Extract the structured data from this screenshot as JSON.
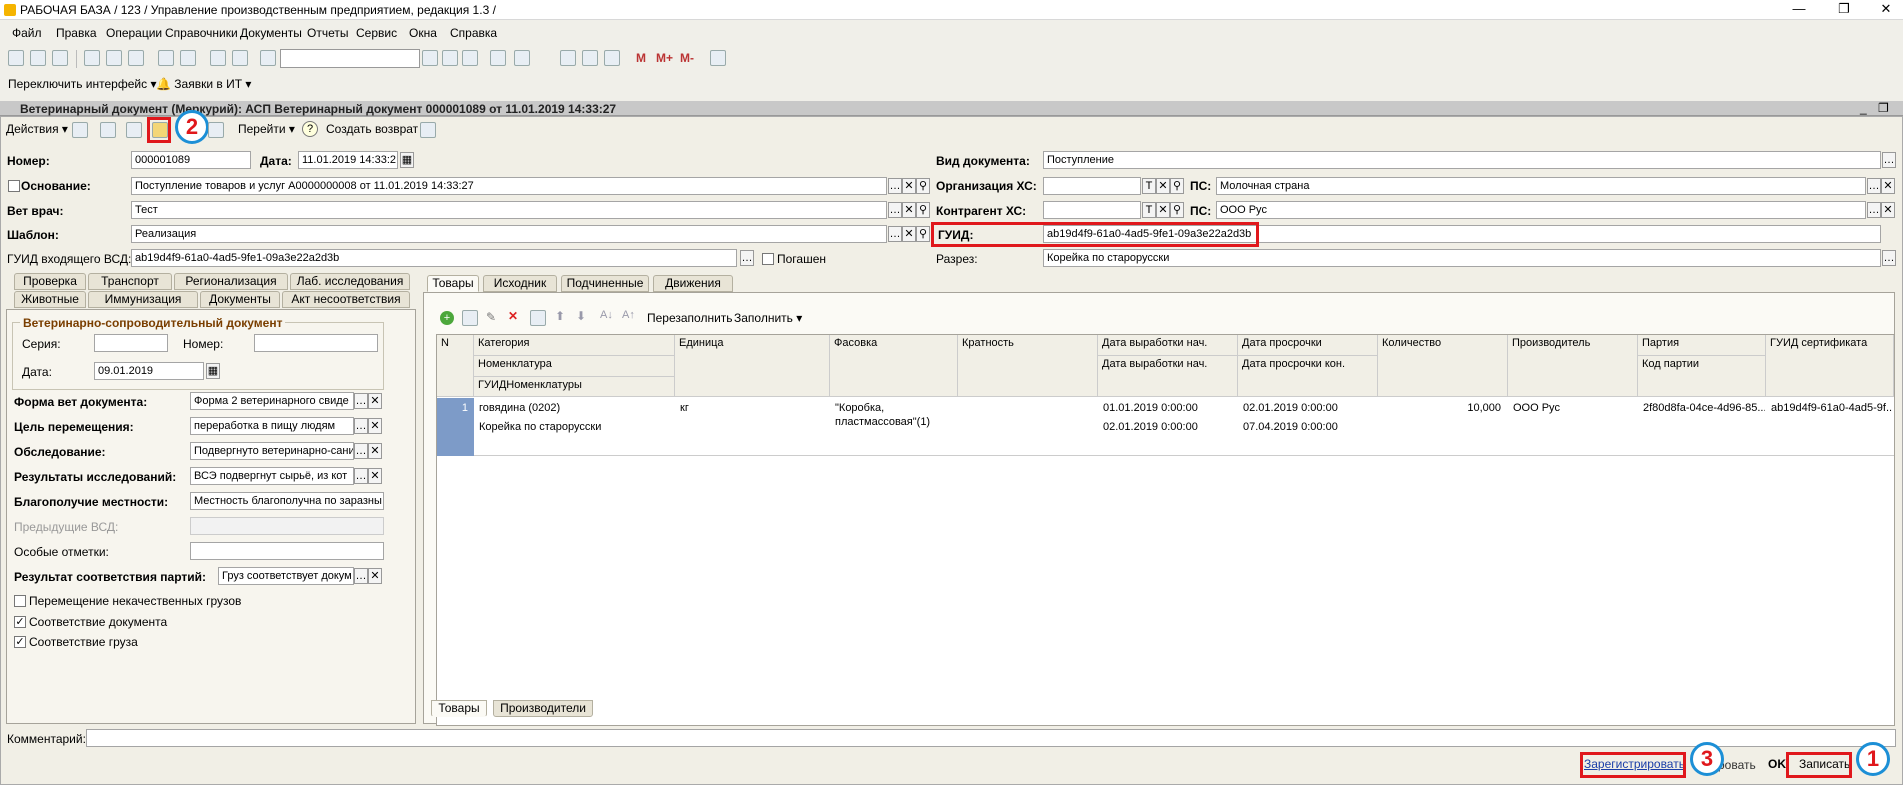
{
  "window": {
    "title": "РАБОЧАЯ БАЗА / 123 /  Управление производственным предприятием, редакция 1.3 /"
  },
  "menu": [
    "Файл",
    "Правка",
    "Операции",
    "Справочники",
    "Документы",
    "Отчеты",
    "Сервис",
    "Окна",
    "Справка"
  ],
  "toolbar2": {
    "switch": "Переключить интерфейс",
    "requests": "Заявки в ИТ"
  },
  "doc": {
    "title": "Ветеринарный документ (Меркурий): АСП Ветеринарный документ 000001089 от 11.01.2019 14:33:27"
  },
  "doctoolbar": {
    "actions": "Действия",
    "goto": "Перейти",
    "create_return": "Создать возврат"
  },
  "form": {
    "number_label": "Номер:",
    "number": "000001089",
    "date_label": "Дата:",
    "date": "11.01.2019 14:33:2",
    "basis_label": "Основание:",
    "basis": "Поступление товаров и услуг А0000000008 от 11.01.2019 14:33:27",
    "vet_label": "Вет врач:",
    "vet": "Тест",
    "template_label": "Шаблон:",
    "template": "Реализация",
    "guid_in_label": "ГУИД входящего ВСД:",
    "guid_in": "ab19d4f9-61a0-4ad5-9fe1-09a3e22a2d3b",
    "extinguished_label": "Погашен",
    "doctype_label": "Вид документа:",
    "doctype": "Поступление",
    "org_label": "Организация ХС:",
    "org": "",
    "ps_label": "ПС:",
    "ps1": "Молочная страна",
    "counter_label": "Контрагент ХС:",
    "counter": "",
    "ps2": "ООО Рус",
    "guid_label": "ГУИД:",
    "guid": "ab19d4f9-61a0-4ad5-9fe1-09a3e22a2d3b",
    "cut_label": "Разрез:",
    "cut": "Корейка по старорусски"
  },
  "lefttabs_row1": [
    "Проверка",
    "Транспорт",
    "Регионализация",
    "Лаб. исследования"
  ],
  "lefttabs_row2": [
    "Животные",
    "Иммунизация",
    "Документы",
    "Акт несоответствия"
  ],
  "vsd": {
    "group": "Ветеринарно-сопроводительный документ",
    "series_label": "Серия:",
    "series": "",
    "num_label": "Номер:",
    "num": "",
    "date_label": "Дата:",
    "date": "09.01.2019",
    "form_label": "Форма вет документа:",
    "form": "Форма 2 ветеринарного свиде",
    "purpose_label": "Цель перемещения:",
    "purpose": "переработка в пищу людям",
    "exam_label": "Обследование:",
    "exam": "Подвергнуто ветеринарно-сани",
    "results_label": "Результаты исследований:",
    "results": "ВСЭ подвергнут сырьё, из кот",
    "welfare_label": "Благополучие местности:",
    "welfare": "Местность благополучна по заразны",
    "prev_label": "Предыдущие ВСД:",
    "prev": "",
    "marks_label": "Особые отметки:",
    "marks": "",
    "conform_label": "Результат соответствия партий:",
    "conform": "Груз соответствует докум",
    "chk1": "Перемещение некачественных грузов",
    "chk2": "Соответствие документа",
    "chk3": "Соответствие груза"
  },
  "righttabs": [
    "Товары",
    "Исходник",
    "Подчиненные",
    "Движения"
  ],
  "gridbar": {
    "refill": "Перезаполнить",
    "fill": "Заполнить"
  },
  "grid": {
    "h": {
      "n": "N",
      "cat": "Категория",
      "nom": "Номенклатура",
      "guidnom": "ГУИДНоменклатуры",
      "unit": "Единица",
      "pack": "Фасовка",
      "mult": "Кратность",
      "prod1": "Дата выработки нач.",
      "prod2": "Дата выработки нач.",
      "exp1": "Дата просрочки",
      "exp2": "Дата просрочки кон.",
      "qty": "Количество",
      "maker": "Производитель",
      "lot": "Партия",
      "lotcode": "Код партии",
      "cert": "ГУИД сертификата"
    },
    "row": {
      "n": "1",
      "cat": "говядина (0202)",
      "nom": "Корейка по старорусски",
      "unit": "кг",
      "pack1": "\"Коробка,",
      "pack2": "пластмассовая\"(1)",
      "prod1": "01.01.2019 0:00:00",
      "prod2": "02.01.2019 0:00:00",
      "exp1": "02.01.2019 0:00:00",
      "exp2": "07.04.2019 0:00:00",
      "qty": "10,000",
      "maker": "ООО Рус",
      "lot": "2f80d8fa-04ce-4d96-85...",
      "cert": "ab19d4f9-61a0-4ad5-9f..."
    }
  },
  "bottomtabs": [
    "Товары",
    "Производители"
  ],
  "comment_label": "Комментарий:",
  "buttons": {
    "register": "Зарегистрировать",
    "annul": "ровать",
    "ok": "OK",
    "save": "Записать"
  },
  "markers": {
    "m1": "1",
    "m2": "2",
    "m3": "3"
  },
  "colors": {
    "accent": "#e0181c",
    "circle": "#1c8fd6"
  }
}
